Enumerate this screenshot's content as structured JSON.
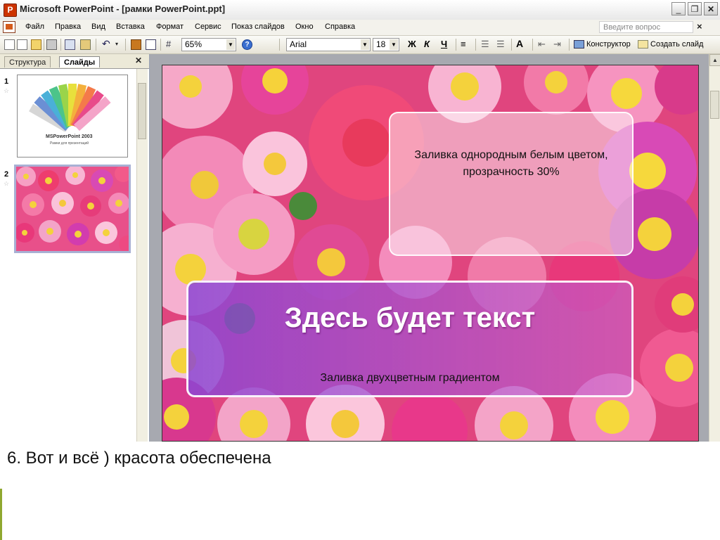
{
  "window": {
    "title": "Microsoft PowerPoint - [рамки PowerPoint.ppt]"
  },
  "menu": {
    "items": [
      "Файл",
      "Правка",
      "Вид",
      "Вставка",
      "Формат",
      "Сервис",
      "Показ слайдов",
      "Окно",
      "Справка"
    ],
    "ask_placeholder": "Введите вопрос"
  },
  "toolbar": {
    "zoom": "65%",
    "font_name": "Arial",
    "font_size": "18",
    "bold": "Ж",
    "italic": "К",
    "underline": "Ч",
    "designer_label": "Конструктор",
    "new_slide_label": "Создать слайд"
  },
  "left_pane": {
    "tab_outline": "Структура",
    "tab_slides": "Слайды",
    "slides": [
      {
        "number": "1",
        "title": "MSPowerPoint 2003",
        "subtitle": "Рамки для презентаций"
      },
      {
        "number": "2"
      }
    ]
  },
  "slide": {
    "box_top_text": "Заливка однородным белым цветом, прозрачность 30%",
    "box_bottom_title": "Здесь будет текст",
    "box_bottom_caption": "Заливка двухцветным градиентом"
  },
  "caption": "6.   Вот и всё ) красота обеспечена",
  "colors": {
    "workspace": "#a7a9b0",
    "gradient_start": "#8c46d2",
    "gradient_end": "#c664d2",
    "titlebar": "#f2f2f2"
  }
}
